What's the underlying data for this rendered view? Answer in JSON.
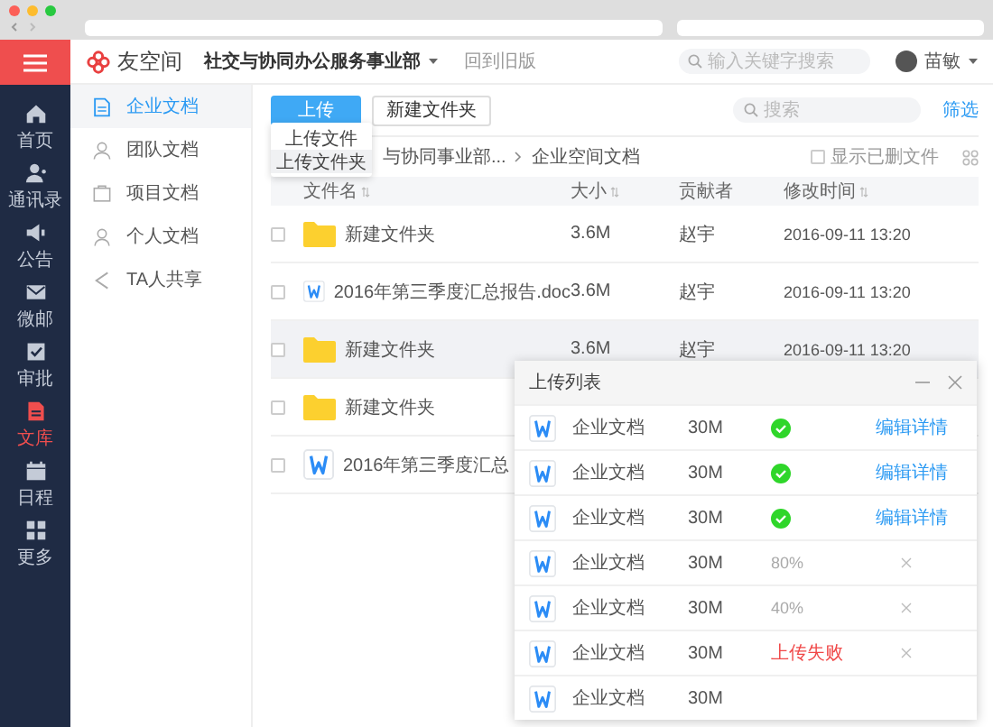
{
  "nav": {
    "items": [
      {
        "label": "首页",
        "kind": "home",
        "selected": false
      },
      {
        "label": "通讯录",
        "kind": "contacts",
        "selected": false
      },
      {
        "label": "公告",
        "kind": "notice",
        "selected": false
      },
      {
        "label": "微邮",
        "kind": "mail",
        "selected": false
      },
      {
        "label": "审批",
        "kind": "approval",
        "selected": false
      },
      {
        "label": "文库",
        "kind": "library",
        "selected": true
      },
      {
        "label": "日程",
        "kind": "calendar",
        "selected": false
      },
      {
        "label": "更多",
        "kind": "more",
        "selected": false
      }
    ]
  },
  "header": {
    "logo": "友空间",
    "org": "社交与协同办公服务事业部",
    "old_version": "回到旧版",
    "search": {
      "placeholder": "输入关键字搜索"
    },
    "user": "苗敏"
  },
  "sidebar": {
    "items": [
      {
        "label": "企业文档",
        "kind": "company",
        "selected": true
      },
      {
        "label": "团队文档",
        "kind": "team",
        "selected": false
      },
      {
        "label": "项目文档",
        "kind": "project",
        "selected": false
      },
      {
        "label": "个人文档",
        "kind": "personal",
        "selected": false
      },
      {
        "label": "TA人共享",
        "kind": "shared",
        "selected": false
      }
    ]
  },
  "toolbar": {
    "upload": "上传",
    "new_folder": "新建文件夹",
    "search": {
      "placeholder": "搜索"
    },
    "filter": "筛选"
  },
  "upload_menu": {
    "items": [
      {
        "label": "上传文件",
        "selected": false
      },
      {
        "label": "上传文件夹",
        "selected": true
      }
    ]
  },
  "breadcrumb": [
    "与协同事业部...",
    "企业空间文档"
  ],
  "show_deleted": {
    "label": "显示已删文件",
    "checked": false
  },
  "table": {
    "columns": [
      {
        "label": "文件名",
        "sortable": true
      },
      {
        "label": "大小",
        "sortable": true
      },
      {
        "label": "贡献者",
        "sortable": false
      },
      {
        "label": "修改时间",
        "sortable": true
      }
    ],
    "rows": [
      {
        "kind": "folder",
        "checked": false,
        "highlighted": false,
        "name": "新建文件夹",
        "size": "3.6M",
        "contributor": "赵宇",
        "modified": "2016-09-11 13:20"
      },
      {
        "kind": "doc",
        "checked": false,
        "highlighted": false,
        "name": "2016年第三季度汇总报告.doc",
        "size": "3.6M",
        "contributor": "赵宇",
        "modified": "2016-09-11 13:20"
      },
      {
        "kind": "folder",
        "checked": false,
        "highlighted": true,
        "name": "新建文件夹",
        "size": "3.6M",
        "contributor": "赵宇",
        "modified": "2016-09-11 13:20"
      },
      {
        "kind": "folder",
        "checked": false,
        "highlighted": false,
        "name": "新建文件夹"
      },
      {
        "kind": "doc",
        "checked": false,
        "highlighted": false,
        "name": "2016年第三季度汇总"
      }
    ]
  },
  "upload_list": {
    "title": "上传列表",
    "rows": [
      {
        "name": "企业文档",
        "size": "30M",
        "kind": "done",
        "action": "编辑详情"
      },
      {
        "name": "企业文档",
        "size": "30M",
        "kind": "done",
        "action": "编辑详情"
      },
      {
        "name": "企业文档",
        "size": "30M",
        "kind": "done",
        "action": "编辑详情"
      },
      {
        "name": "企业文档",
        "size": "30M",
        "kind": "progress",
        "status": "80%"
      },
      {
        "name": "企业文档",
        "size": "30M",
        "kind": "progress",
        "status": "40%"
      },
      {
        "name": "企业文档",
        "size": "30M",
        "kind": "failed",
        "status": "上传失败"
      },
      {
        "name": "企业文档",
        "size": "30M",
        "kind": "pending"
      }
    ]
  }
}
